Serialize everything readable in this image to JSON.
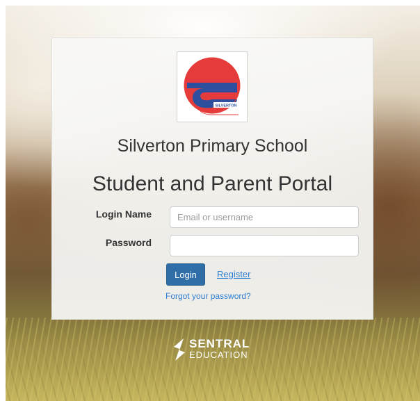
{
  "school": {
    "name": "Silverton Primary School",
    "logo_text": "SILVERTON"
  },
  "portal": {
    "title": "Student and Parent Portal"
  },
  "form": {
    "login_label": "Login Name",
    "login_placeholder": "Email or username",
    "login_value": "",
    "password_label": "Password",
    "password_value": "",
    "login_button": "Login",
    "register_link": "Register",
    "forgot_link": "Forgot your password?"
  },
  "brand": {
    "word": "SENTRAL",
    "sub": "EDUCATION"
  },
  "colors": {
    "button_primary": "#2f6ea6",
    "link": "#2d7fd3",
    "logo_red": "#e63b3b",
    "logo_blue": "#2e4f9e"
  }
}
